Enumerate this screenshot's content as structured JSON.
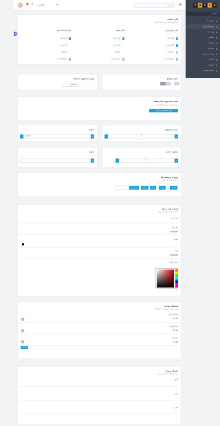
{
  "topbar": {
    "language": "انگلیسی",
    "search_placeholder": "جستجو",
    "menu_icon": "hamburger-icon",
    "logo_letters": [
      "Z",
      "A",
      "V",
      "I",
      "A"
    ]
  },
  "sidebar": {
    "header": "داشبورد",
    "items": [
      {
        "label": "ترجمه ها",
        "active": false
      },
      {
        "label": "زمینه های فرم",
        "active": true
      },
      {
        "label": "ویجت ها",
        "active": false
      },
      {
        "label": "اسلایدر",
        "active": false
      },
      {
        "label": "فرم ها",
        "active": false
      },
      {
        "label": "ثبت نام",
        "active": false
      },
      {
        "label": "صفحات عمومی",
        "active": false
      },
      {
        "label": "لاگ ها",
        "active": false
      },
      {
        "label": "تنظیمات",
        "active": false
      },
      {
        "label": "صفحه دوستان",
        "active": false
      }
    ]
  },
  "checkbox_card": {
    "title": "کادر انتخاب",
    "subtitle": "گزینه مورد نظر خود را انتخاب کنید",
    "columns": [
      {
        "header": "کادر پیش فرض",
        "items": [
          {
            "label": "گزینه اول",
            "state": "checked"
          },
          {
            "label": "گزینه دوم",
            "state": "checked"
          },
          {
            "label": "غیرفعال",
            "state": "empty"
          },
          {
            "label": "غیرفعال شده",
            "state": "checked"
          }
        ]
      },
      {
        "header": "کادر اصلی",
        "items": [
          {
            "label": "گزینه اول",
            "state": "checked"
          },
          {
            "label": "گزینه دوم",
            "state": "empty"
          },
          {
            "label": "غیرفعال",
            "state": "empty"
          },
          {
            "label": "غیرفعال شده",
            "state": "checked"
          }
        ]
      },
      {
        "header": "کادر انتخاب خطر",
        "items": [
          {
            "label": "گزینه اول",
            "state": "danger"
          },
          {
            "label": "گزینه دوم",
            "state": "empty"
          },
          {
            "label": "غیرفعال",
            "state": "empty"
          },
          {
            "label": "غیرفعال شده",
            "state": "danger"
          }
        ]
      }
    ]
  },
  "toggle_card": {
    "title": "تغییر سوئیچ"
  },
  "shared_search_card": {
    "title": "فرم جستجوی مشترک",
    "input_value": "جستجو"
  },
  "full_search_card": {
    "title": "جعبه جستجوی تمام صفحه",
    "subtitle": "برای باز کردن جستجو کلیک کنید",
    "button_label": "کادر جستجو را باز کنید"
  },
  "steppers": [
    {
      "title": "نمونه",
      "value": "10.00"
    },
    {
      "title": "حسی معمولی",
      "value": "0"
    },
    {
      "title": "نمونه",
      "value": ""
    },
    {
      "title": "پیشوند حسی",
      "value": "0"
    }
  ],
  "tags_card": {
    "title": "ورودی برچسب ها",
    "subtitle": "برچسب ها را وارد کنید",
    "tags": [
      "امنیت",
      "زمینه",
      "مدل",
      "برنامه",
      "کد نویسی"
    ]
  },
  "color_card": {
    "title": "انتخاب کننده رنگ",
    "subtitle": "انتخاب رنگ با استفاده از پیکر",
    "fields": [
      {
        "label": "حالت ساده",
        "value": ""
      },
      {
        "label": "رنگ هگز",
        "value": "#000000"
      },
      {
        "label": "نمونه",
        "value": ""
      },
      {
        "label": "آلفا",
        "value": "#000000"
      },
      {
        "label": "درون خطی",
        "value": ""
      }
    ]
  },
  "time_card": {
    "title": "انتخابگر ساعت",
    "subtitle": "ورود ساعت با استفاده از انتخابگر",
    "fields": [
      {
        "label": "انتخابگر زمان",
        "value": "12:00"
      },
      {
        "label": "زمان شروع",
        "value": "13:14"
      },
      {
        "label": "پایین کار",
        "value": "11:00"
      }
    ],
    "button_label": "انتخاب"
  },
  "mask_card": {
    "title": "ماسک ورودی",
    "subtitle": "ورود اطلاعات با ماسک ورودی",
    "fields": [
      {
        "label": "تاریخ"
      },
      {
        "label": "ساعت"
      },
      {
        "label": "تلفن"
      }
    ]
  },
  "colors": {
    "accent": "#1ea1d9",
    "danger": "#e05a4f",
    "sidebar": "#3b4250"
  }
}
